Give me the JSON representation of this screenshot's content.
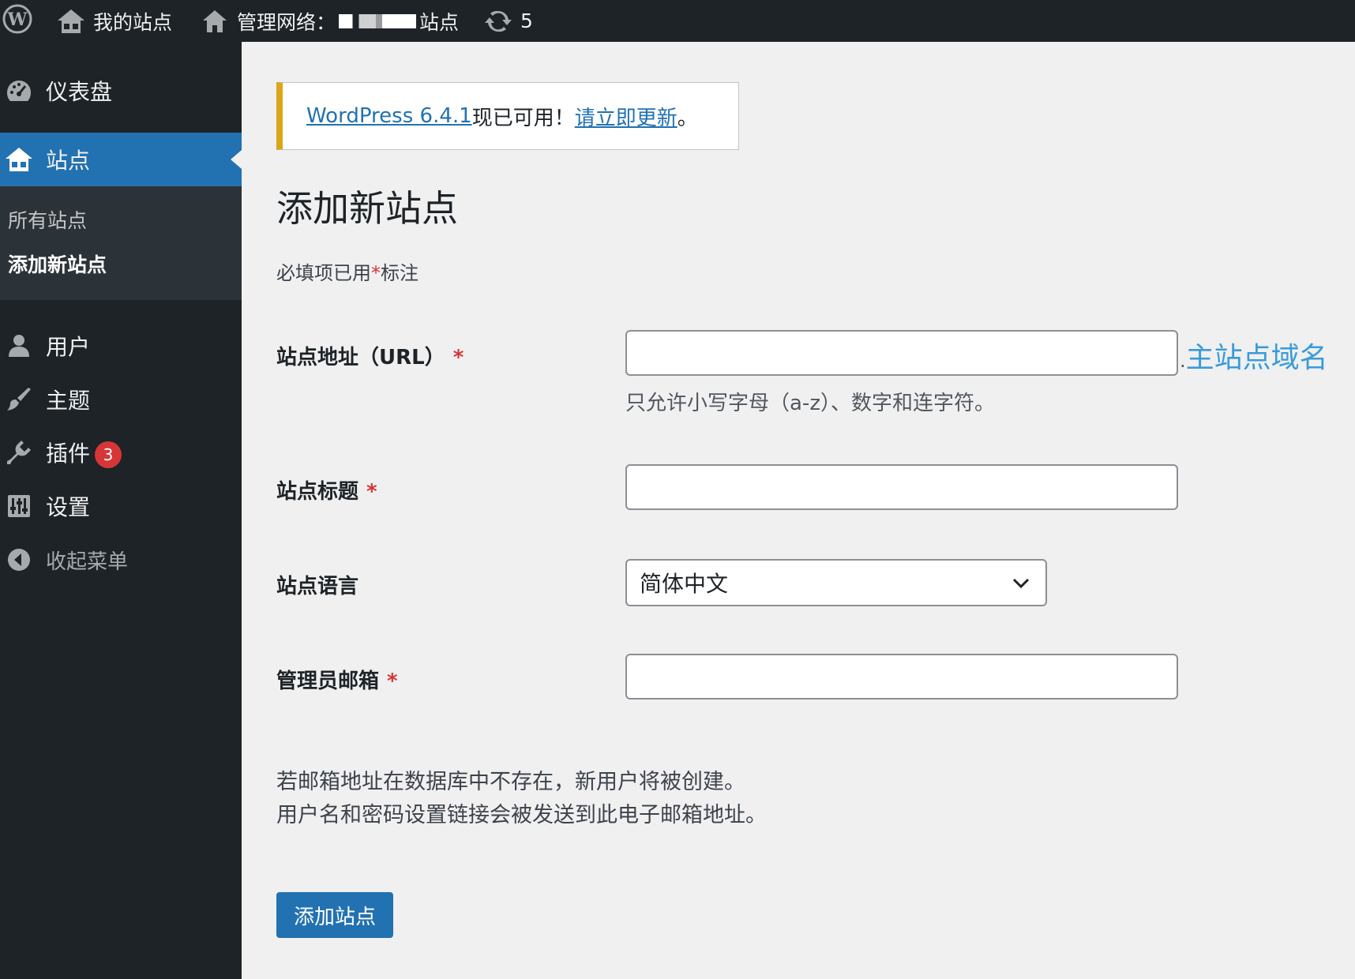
{
  "adminbar": {
    "my_sites": "我的站点",
    "network_admin": "管理网络：",
    "network_site_suffix": "站点",
    "updates_count": "5"
  },
  "sidebar": {
    "dashboard": "仪表盘",
    "sites": "站点",
    "sites_all": "所有站点",
    "sites_add": "添加新站点",
    "users": "用户",
    "themes": "主题",
    "plugins": "插件",
    "plugins_badge": "3",
    "settings": "设置",
    "collapse": "收起菜单"
  },
  "notice": {
    "link": "WordPress 6.4.1",
    "text": "现已可用！",
    "update_link": "请立即更新",
    "end": "。"
  },
  "page": {
    "title": "添加新站点",
    "required_prefix": "必填项已用",
    "required_star": "*",
    "required_suffix": "标注"
  },
  "form": {
    "url_label": "站点地址（URL）",
    "url_domain_dot": ".",
    "url_domain": "主站点域名",
    "url_help": "只允许小写字母（a-z）、数字和连字符。",
    "title_label": "站点标题",
    "language_label": "站点语言",
    "language_value": "简体中文",
    "email_label": "管理员邮箱",
    "star": "*",
    "info_line1": "若邮箱地址在数据库中不存在，新用户将被创建。",
    "info_line2": "用户名和密码设置链接会被发送到此电子邮箱地址。",
    "submit": "添加站点"
  },
  "colors": {
    "adminbar_bg": "#1d2327",
    "accent": "#2271b1",
    "notice_border": "#dba617",
    "required": "#d63638"
  },
  "icons": {
    "wp": "wordpress-logo-icon",
    "my_sites": "sites-icon",
    "network": "home-icon",
    "updates": "refresh-icon",
    "dashboard": "dashboard-icon",
    "users": "user-icon",
    "themes": "brush-icon",
    "plugins": "plug-icon",
    "settings": "settings-sliders-icon",
    "collapse": "collapse-arrow-icon",
    "select": "chevron-down-icon"
  }
}
